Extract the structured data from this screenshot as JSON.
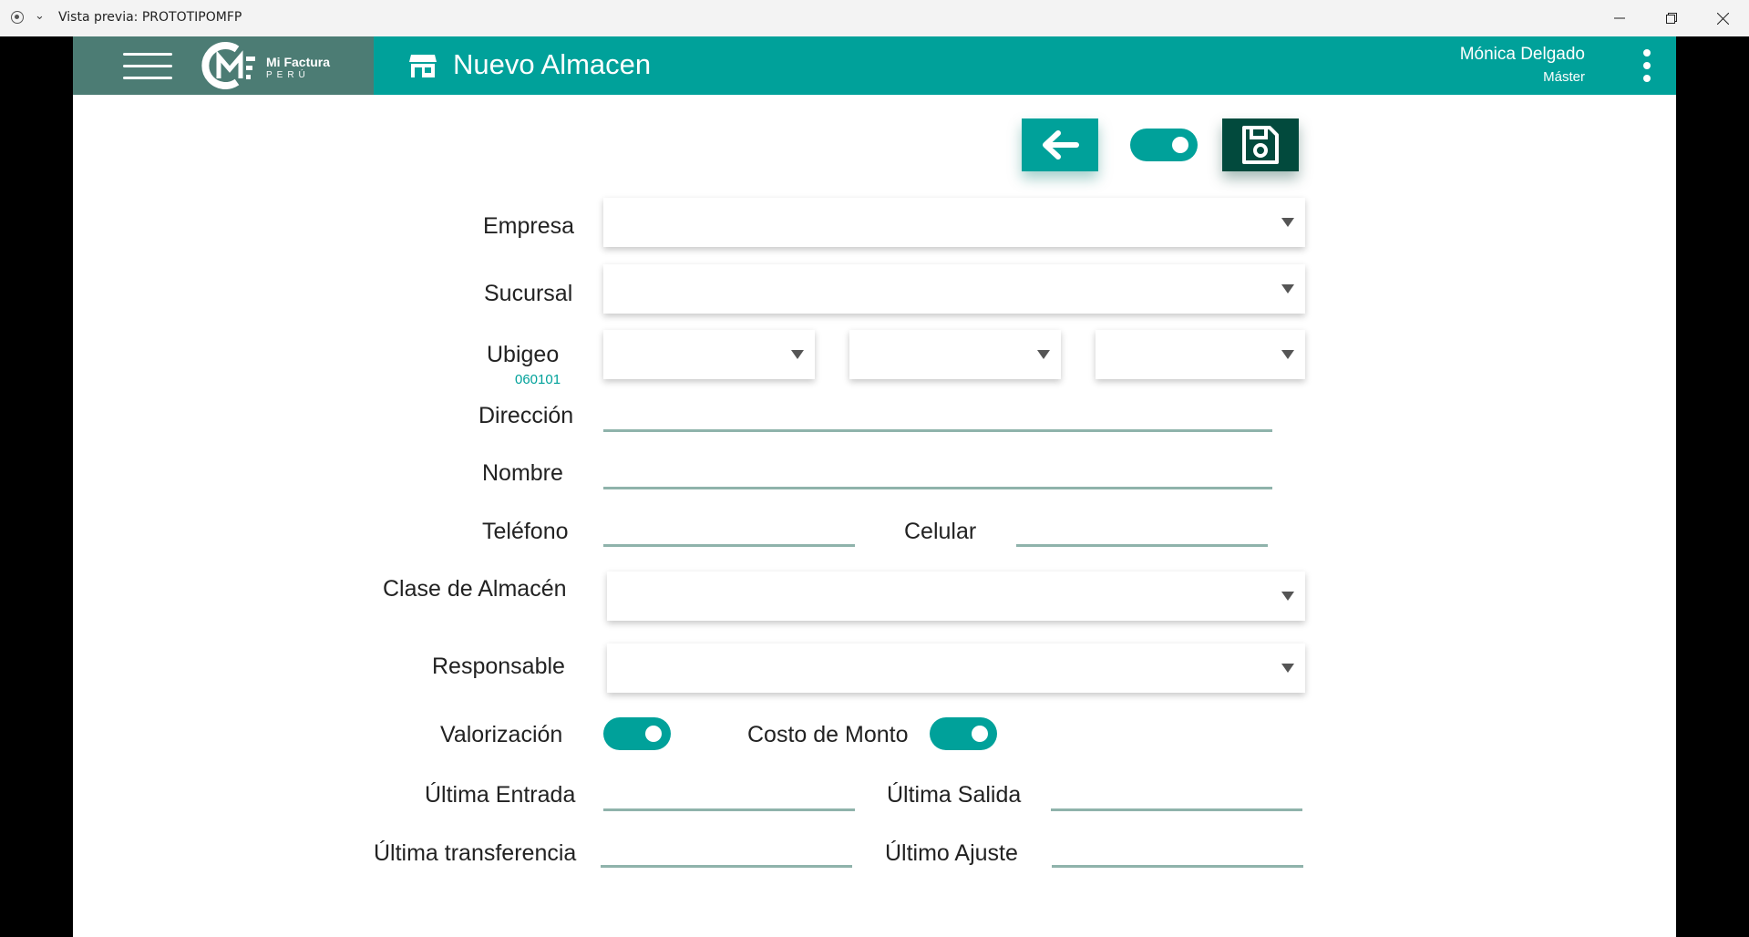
{
  "window": {
    "title": "Vista previa: PROTOTIPOMFP"
  },
  "brand": {
    "line1": "Mi Factura",
    "line2": "PERÚ"
  },
  "header": {
    "title": "Nuevo Almacen",
    "user_name": "Mónica Delgado",
    "user_role": "Máster"
  },
  "form": {
    "empresa": {
      "label": "Empresa",
      "value": ""
    },
    "sucursal": {
      "label": "Sucursal",
      "value": ""
    },
    "ubigeo": {
      "label": "Ubigeo",
      "code": "060101",
      "values": [
        "",
        "",
        ""
      ]
    },
    "direccion": {
      "label": "Dirección",
      "value": ""
    },
    "nombre": {
      "label": "Nombre",
      "value": ""
    },
    "telefono": {
      "label": "Teléfono",
      "value": ""
    },
    "celular": {
      "label": "Celular",
      "value": ""
    },
    "clase_almacen": {
      "label": "Clase de Almacén",
      "value": ""
    },
    "responsable": {
      "label": "Responsable",
      "value": ""
    },
    "valorizacion": {
      "label": "Valorización",
      "on": true
    },
    "costo_monto": {
      "label": "Costo de Monto",
      "on": true
    },
    "ultima_entrada": {
      "label": "Última Entrada",
      "value": ""
    },
    "ultima_salida": {
      "label": "Última Salida",
      "value": ""
    },
    "ultima_transferencia": {
      "label": "Última transferencia",
      "value": ""
    },
    "ultimo_ajuste": {
      "label": "Último Ajuste",
      "value": ""
    }
  },
  "toolbar": {
    "active_on": true
  },
  "icons": {
    "back": "arrow-left-icon",
    "save": "floppy-disk-icon",
    "store": "store-icon",
    "menu": "hamburger-icon",
    "more": "kebab-icon"
  },
  "colors": {
    "primary": "#00a19a",
    "brand_bg": "#4c7c74",
    "save_bg": "#024a3d",
    "underline": "#8fb3ab"
  }
}
